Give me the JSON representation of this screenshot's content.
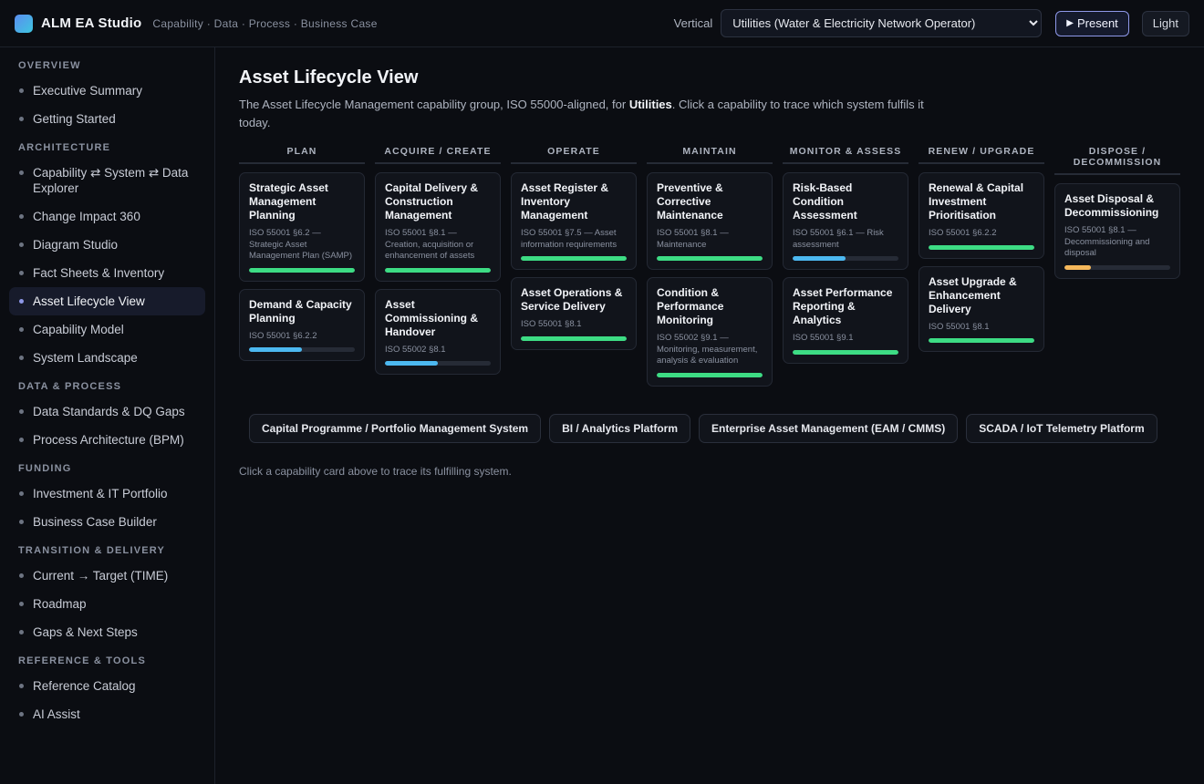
{
  "app": {
    "title": "ALM EA Studio",
    "tagline": "Capability · Data · Process · Business Case"
  },
  "header": {
    "vertical_label": "Vertical",
    "vertical_selected": "Utilities (Water & Electricity Network Operator)",
    "present_label": "Present",
    "light_label": "Light"
  },
  "sidebar": {
    "sections": [
      {
        "heading": "OVERVIEW",
        "items": [
          "Executive Summary",
          "Getting Started"
        ]
      },
      {
        "heading": "ARCHITECTURE",
        "items": [
          "Capability ⇄ System ⇄ Data Explorer",
          "Change Impact 360",
          "Diagram Studio",
          "Fact Sheets & Inventory",
          "Asset Lifecycle View",
          "Capability Model",
          "System Landscape"
        ]
      },
      {
        "heading": "DATA & PROCESS",
        "items": [
          "Data Standards & DQ Gaps",
          "Process Architecture (BPM)"
        ]
      },
      {
        "heading": "FUNDING",
        "items": [
          "Investment & IT Portfolio",
          "Business Case Builder"
        ]
      },
      {
        "heading": "TRANSITION & DELIVERY",
        "items": [
          "Current → Target (TIME)",
          "Roadmap",
          "Gaps & Next Steps"
        ]
      },
      {
        "heading": "REFERENCE & TOOLS",
        "items": [
          "Reference Catalog",
          "AI Assist"
        ]
      }
    ],
    "active_item": "Asset Lifecycle View"
  },
  "main": {
    "title": "Asset Lifecycle View",
    "desc_before": "The Asset Lifecycle Management capability group, ISO 55000-aligned, for ",
    "desc_bold": "Utilities",
    "desc_after": ". Click a capability to trace which system fulfils it today.",
    "hint": "Click a capability card above to trace its fulfilling system."
  },
  "colors": {
    "green": "#3ddc84",
    "blue": "#4cb8f0",
    "amber": "#f5b85b"
  },
  "lanes": [
    {
      "name": "PLAN",
      "cards": [
        {
          "title": "Strategic Asset Management Planning",
          "ref": "ISO 55001 §6.2 — Strategic Asset Management Plan (SAMP)",
          "level": 1.0,
          "color": "green"
        },
        {
          "title": "Demand & Capacity Planning",
          "ref": "ISO 55001 §6.2.2",
          "level": 0.5,
          "color": "blue"
        }
      ]
    },
    {
      "name": "ACQUIRE / CREATE",
      "cards": [
        {
          "title": "Capital Delivery & Construction Management",
          "ref": "ISO 55001 §8.1 — Creation, acquisition or enhancement of assets",
          "level": 1.0,
          "color": "green"
        },
        {
          "title": "Asset Commissioning & Handover",
          "ref": "ISO 55002 §8.1",
          "level": 0.5,
          "color": "blue"
        }
      ]
    },
    {
      "name": "OPERATE",
      "cards": [
        {
          "title": "Asset Register & Inventory Management",
          "ref": "ISO 55001 §7.5 — Asset information requirements",
          "level": 1.0,
          "color": "green"
        },
        {
          "title": "Asset Operations & Service Delivery",
          "ref": "ISO 55001 §8.1",
          "level": 1.0,
          "color": "green"
        }
      ]
    },
    {
      "name": "MAINTAIN",
      "cards": [
        {
          "title": "Preventive & Corrective Maintenance",
          "ref": "ISO 55001 §8.1 — Maintenance",
          "level": 1.0,
          "color": "green"
        },
        {
          "title": "Condition & Performance Monitoring",
          "ref": "ISO 55002 §9.1 — Monitoring, measurement, analysis & evaluation",
          "level": 1.0,
          "color": "green"
        }
      ]
    },
    {
      "name": "MONITOR & ASSESS",
      "cards": [
        {
          "title": "Risk-Based Condition Assessment",
          "ref": "ISO 55001 §6.1 — Risk assessment",
          "level": 0.5,
          "color": "blue"
        },
        {
          "title": "Asset Performance Reporting & Analytics",
          "ref": "ISO 55001 §9.1",
          "level": 1.0,
          "color": "green"
        }
      ]
    },
    {
      "name": "RENEW / UPGRADE",
      "cards": [
        {
          "title": "Renewal & Capital Investment Prioritisation",
          "ref": "ISO 55001 §6.2.2",
          "level": 1.0,
          "color": "green"
        },
        {
          "title": "Asset Upgrade & Enhancement Delivery",
          "ref": "ISO 55001 §8.1",
          "level": 1.0,
          "color": "green"
        }
      ]
    },
    {
      "name": "DISPOSE / DECOMMISSION",
      "cards": [
        {
          "title": "Asset Disposal & Decommissioning",
          "ref": "ISO 55001 §8.1 — Decommissioning and disposal",
          "level": 0.25,
          "color": "amber"
        }
      ]
    }
  ],
  "systems": [
    "Capital Programme / Portfolio Management System",
    "BI / Analytics Platform",
    "Enterprise Asset Management (EAM / CMMS)",
    "SCADA / IoT Telemetry Platform"
  ]
}
